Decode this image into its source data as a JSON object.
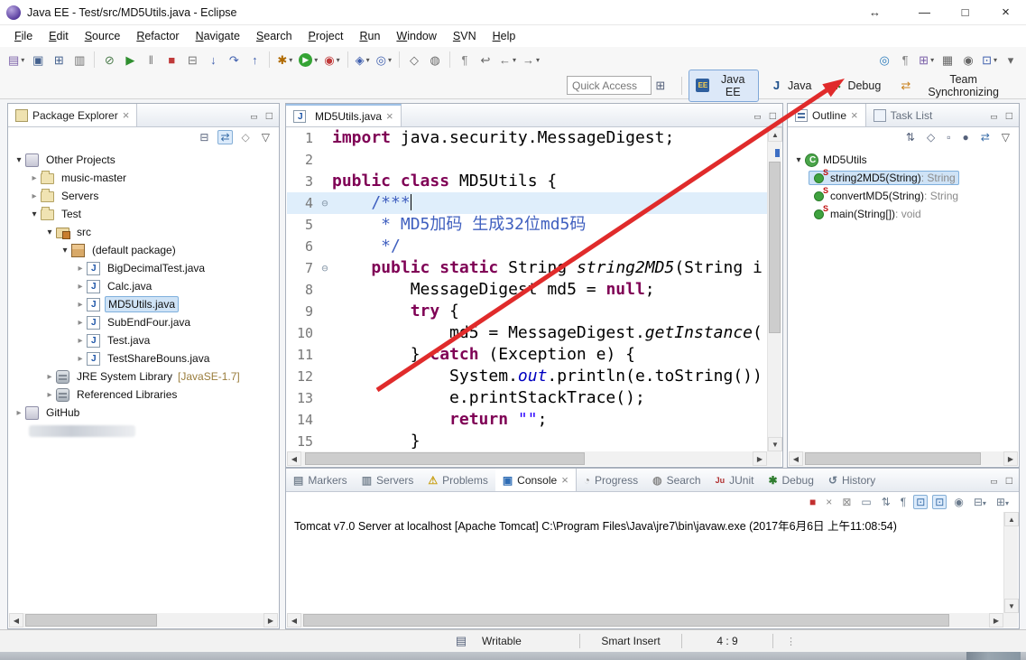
{
  "window": {
    "title": "Java EE - Test/src/MD5Utils.java - Eclipse",
    "controls": {
      "resize": "↔",
      "minimize": "—",
      "maximize": "□",
      "close": "×"
    }
  },
  "menu": [
    "File",
    "Edit",
    "Source",
    "Refactor",
    "Navigate",
    "Search",
    "Project",
    "Run",
    "Window",
    "SVN",
    "Help"
  ],
  "toolbar": {
    "quick_access": "Quick Access",
    "icons": [
      {
        "name": "new",
        "glyph": "▤",
        "color": "#7a5fa8",
        "dropdown": true
      },
      {
        "name": "save",
        "glyph": "▣",
        "color": "#44618e"
      },
      {
        "name": "save-all",
        "glyph": "⊞",
        "color": "#44618e"
      },
      {
        "name": "print",
        "glyph": "▥",
        "color": "#6e6e6e"
      },
      {
        "sep": true
      },
      {
        "name": "skip-all-breakpoints",
        "glyph": "⊘",
        "color": "#4a7a4a"
      },
      {
        "name": "resume",
        "glyph": "▶",
        "color": "#2f8f2f"
      },
      {
        "name": "suspend",
        "glyph": "‖",
        "color": "#777777"
      },
      {
        "name": "terminate",
        "glyph": "■",
        "color": "#c03a3a"
      },
      {
        "name": "disconnect",
        "glyph": "⊟",
        "color": "#777777"
      },
      {
        "name": "step-into",
        "glyph": "↓",
        "color": "#3f5fae"
      },
      {
        "name": "step-over",
        "glyph": "↷",
        "color": "#3f5fae"
      },
      {
        "name": "step-return",
        "glyph": "↑",
        "color": "#3f5fae"
      },
      {
        "sep": true
      },
      {
        "name": "external-tools",
        "glyph": "✱",
        "color": "#b06a00",
        "dropdown": true
      },
      {
        "name": "run",
        "glyph": "▶",
        "color": "#ffffff",
        "circle": "#35a435",
        "dropdown": true
      },
      {
        "name": "coverage",
        "glyph": "◉",
        "color": "#c03a3a",
        "dropdown": true
      },
      {
        "sep": true
      },
      {
        "name": "new-web-wizard",
        "glyph": "◈",
        "color": "#3f5fae",
        "dropdown": true
      },
      {
        "name": "web-browser",
        "glyph": "◎",
        "color": "#3f5fae",
        "dropdown": true
      },
      {
        "sep": true
      },
      {
        "name": "open-type",
        "glyph": "◇",
        "color": "#666666"
      },
      {
        "name": "search",
        "glyph": "◍",
        "color": "#666666"
      },
      {
        "sep": true
      },
      {
        "name": "mark-occurrences",
        "glyph": "¶",
        "color": "#888888"
      },
      {
        "name": "last-edit-location",
        "glyph": "↩",
        "color": "#666666"
      },
      {
        "name": "back",
        "glyph": "←",
        "color": "#666666",
        "dropdown": true
      },
      {
        "name": "forward",
        "glyph": "→",
        "color": "#666666",
        "dropdown": true
      }
    ],
    "icons_right": [
      {
        "name": "web-page",
        "glyph": "◎",
        "color": "#2b7bbb"
      },
      {
        "name": "show-whitespace",
        "glyph": "¶",
        "color": "#888888"
      },
      {
        "name": "new-java-ee-project",
        "glyph": "⊞",
        "color": "#7a5fa8",
        "dropdown": true
      },
      {
        "name": "palette",
        "glyph": "▦",
        "color": "#666666"
      },
      {
        "name": "pin-editor",
        "glyph": "◉",
        "color": "#666666"
      },
      {
        "name": "editor-windows",
        "glyph": "⊡",
        "color": "#3f5fae",
        "dropdown": true
      },
      {
        "name": "more-toolbar-items",
        "glyph": "▾",
        "color": "#666666"
      }
    ],
    "perspectives": [
      {
        "name": "java-ee",
        "label": "Java EE",
        "active": true
      },
      {
        "name": "java",
        "label": "Java",
        "active": false
      },
      {
        "name": "debug",
        "label": "Debug",
        "active": false
      },
      {
        "name": "team-synchronizing",
        "label": "Team Synchronizing",
        "active": false
      }
    ]
  },
  "package_explorer": {
    "title": "Package Explorer",
    "tool_icons": [
      {
        "name": "collapse-all",
        "glyph": "⊟",
        "color": "#55617a"
      },
      {
        "name": "link-with-editor",
        "glyph": "⇄",
        "color": "#3a6ea8",
        "active": true
      },
      {
        "name": "filters",
        "glyph": "◇",
        "color": "#8a8a8a"
      },
      {
        "name": "view-menu",
        "glyph": "▽",
        "color": "#555555"
      }
    ],
    "tree": [
      {
        "level": 0,
        "expander": "expanded",
        "icon": "workingset",
        "label": "Other Projects"
      },
      {
        "level": 1,
        "expander": "collapsed",
        "icon": "project",
        "label": "music-master"
      },
      {
        "level": 1,
        "expander": "collapsed",
        "icon": "project",
        "label": "Servers"
      },
      {
        "level": 1,
        "expander": "expanded",
        "icon": "project",
        "label": "Test"
      },
      {
        "level": 2,
        "expander": "expanded",
        "icon": "src",
        "label": "src"
      },
      {
        "level": 3,
        "expander": "expanded",
        "icon": "package",
        "label": "(default package)"
      },
      {
        "level": 4,
        "expander": "collapsed",
        "icon": "javafile",
        "label": "BigDecimalTest.java"
      },
      {
        "level": 4,
        "expander": "collapsed",
        "icon": "javafile",
        "label": "Calc.java"
      },
      {
        "level": 4,
        "expander": "collapsed",
        "icon": "javafile",
        "label": "MD5Utils.java",
        "selected": true
      },
      {
        "level": 4,
        "expander": "collapsed",
        "icon": "javafile",
        "label": "SubEndFour.java"
      },
      {
        "level": 4,
        "expander": "collapsed",
        "icon": "javafile",
        "label": "Test.java"
      },
      {
        "level": 4,
        "expander": "collapsed",
        "icon": "javafile",
        "label": "TestShareBouns.java"
      },
      {
        "level": 2,
        "expander": "collapsed",
        "icon": "library",
        "label": "JRE System Library",
        "detail": "[JavaSE-1.7]"
      },
      {
        "level": 2,
        "expander": "collapsed",
        "icon": "library",
        "label": "Referenced Libraries"
      },
      {
        "level": 0,
        "expander": "collapsed",
        "icon": "workingset",
        "label": "GitHub"
      },
      {
        "level": 0,
        "expander": "none",
        "icon": "redacted",
        "label": ""
      }
    ]
  },
  "editor": {
    "tab": "MD5Utils.java",
    "lines": [
      {
        "n": 1,
        "tokens": [
          {
            "t": "k",
            "v": "import"
          },
          {
            "t": "p",
            "v": " java.security.MessageDigest;"
          }
        ]
      },
      {
        "n": 2,
        "tokens": []
      },
      {
        "n": 3,
        "tokens": [
          {
            "t": "k",
            "v": "public"
          },
          {
            "t": "p",
            "v": " "
          },
          {
            "t": "k",
            "v": "class"
          },
          {
            "t": "p",
            "v": " MD5Utils {"
          }
        ]
      },
      {
        "n": 4,
        "fold": true,
        "current": true,
        "tokens": [
          {
            "t": "c",
            "v": "    /***"
          }
        ]
      },
      {
        "n": 5,
        "tokens": [
          {
            "t": "c",
            "v": "     * MD5加码 生成32位md5码"
          }
        ]
      },
      {
        "n": 6,
        "tokens": [
          {
            "t": "c",
            "v": "     */"
          }
        ]
      },
      {
        "n": 7,
        "fold": true,
        "tokens": [
          {
            "t": "p",
            "v": "    "
          },
          {
            "t": "k",
            "v": "public"
          },
          {
            "t": "p",
            "v": " "
          },
          {
            "t": "k",
            "v": "static"
          },
          {
            "t": "p",
            "v": " String "
          },
          {
            "t": "si",
            "v": "string2MD5"
          },
          {
            "t": "p",
            "v": "(String i"
          }
        ]
      },
      {
        "n": 8,
        "tokens": [
          {
            "t": "p",
            "v": "        MessageDigest md5 = "
          },
          {
            "t": "k",
            "v": "null"
          },
          {
            "t": "p",
            "v": ";"
          }
        ]
      },
      {
        "n": 9,
        "tokens": [
          {
            "t": "p",
            "v": "        "
          },
          {
            "t": "k",
            "v": "try"
          },
          {
            "t": "p",
            "v": " {"
          }
        ]
      },
      {
        "n": 10,
        "tokens": [
          {
            "t": "p",
            "v": "            md5 = MessageDigest."
          },
          {
            "t": "si",
            "v": "getInstance"
          },
          {
            "t": "p",
            "v": "("
          }
        ]
      },
      {
        "n": 11,
        "tokens": [
          {
            "t": "p",
            "v": "        } "
          },
          {
            "t": "k",
            "v": "catch"
          },
          {
            "t": "p",
            "v": " (Exception e) {"
          }
        ]
      },
      {
        "n": 12,
        "tokens": [
          {
            "t": "p",
            "v": "            System."
          },
          {
            "t": "sf",
            "v": "out"
          },
          {
            "t": "p",
            "v": ".println(e.toString())"
          }
        ]
      },
      {
        "n": 13,
        "tokens": [
          {
            "t": "p",
            "v": "            e.printStackTrace();"
          }
        ]
      },
      {
        "n": 14,
        "tokens": [
          {
            "t": "p",
            "v": "            "
          },
          {
            "t": "k",
            "v": "return"
          },
          {
            "t": "p",
            "v": " "
          },
          {
            "t": "s",
            "v": "\"\""
          },
          {
            "t": "p",
            "v": ";"
          }
        ]
      },
      {
        "n": 15,
        "tokens": [
          {
            "t": "p",
            "v": "        }"
          }
        ]
      }
    ]
  },
  "outline": {
    "tab": "Outline",
    "tab2": "Task List",
    "root": "MD5Utils",
    "tool_icons": [
      {
        "name": "sort",
        "glyph": "⇅",
        "color": "#55617a"
      },
      {
        "name": "hide-fields",
        "glyph": "◇",
        "color": "#55617a"
      },
      {
        "name": "hide-static",
        "glyph": "▫",
        "color": "#55617a"
      },
      {
        "name": "hide-non-public",
        "glyph": "●",
        "color": "#55617a"
      },
      {
        "name": "link-with-editor",
        "glyph": "⇄",
        "color": "#3a6ea8"
      },
      {
        "name": "view-menu",
        "glyph": "▽",
        "color": "#555555"
      }
    ],
    "members": [
      {
        "name": "string2MD5(String)",
        "type": " : String",
        "static": true,
        "selected": true
      },
      {
        "name": "convertMD5(String)",
        "type": " : String",
        "static": true
      },
      {
        "name": "main(String[])",
        "type": " : void",
        "static": true
      }
    ]
  },
  "console": {
    "active": "Console",
    "tabs": [
      {
        "label": "Markers",
        "glyph": "▤",
        "color": "#7b8794"
      },
      {
        "label": "Servers",
        "glyph": "▥",
        "color": "#7b8794"
      },
      {
        "label": "Problems",
        "glyph": "⚠",
        "color": "#c9a11a"
      },
      {
        "label": "Console",
        "glyph": "▣",
        "color": "#2f6db5"
      },
      {
        "label": "Progress",
        "glyph": "◔",
        "color": "#8a8a8a"
      },
      {
        "label": "Search",
        "glyph": "◍",
        "color": "#8a8a8a"
      },
      {
        "label": "JUnit",
        "glyph": "Ju",
        "color": "#b03030"
      },
      {
        "label": "Debug",
        "glyph": "✱",
        "color": "#2f7d2f"
      },
      {
        "label": "History",
        "glyph": "↺",
        "color": "#6b7b8d"
      }
    ],
    "tool_icons": [
      {
        "name": "terminate",
        "glyph": "■",
        "color": "#c22f2f"
      },
      {
        "name": "remove-launch",
        "glyph": "×",
        "color": "#8a8a8a"
      },
      {
        "name": "remove-all-terminated",
        "glyph": "⊠",
        "color": "#8a8a8a"
      },
      {
        "name": "clear-console",
        "glyph": "▭",
        "color": "#6b7b8d"
      },
      {
        "name": "scroll-lock",
        "glyph": "⇅",
        "color": "#6b7b8d"
      },
      {
        "name": "word-wrap",
        "glyph": "¶",
        "color": "#6b7b8d"
      },
      {
        "name": "show-on-stdout",
        "glyph": "⊡",
        "color": "#3a6ea8",
        "active": true
      },
      {
        "name": "show-on-stderr",
        "glyph": "⊡",
        "color": "#3a6ea8",
        "active": true
      },
      {
        "name": "pin-console",
        "glyph": "◉",
        "color": "#6b7b8d"
      },
      {
        "name": "display-selected-console",
        "glyph": "⊟",
        "color": "#6b7b8d",
        "dropdown": true
      },
      {
        "name": "open-console",
        "glyph": "⊞",
        "color": "#6b7b8d",
        "dropdown": true
      }
    ],
    "line": "Tomcat v7.0 Server at localhost [Apache Tomcat] C:\\Program Files\\Java\\jre7\\bin\\javaw.exe (2017年6月6日 上午11:08:54)"
  },
  "status_bar": {
    "writable": "Writable",
    "smart_insert": "Smart Insert",
    "position": "4 : 9"
  }
}
